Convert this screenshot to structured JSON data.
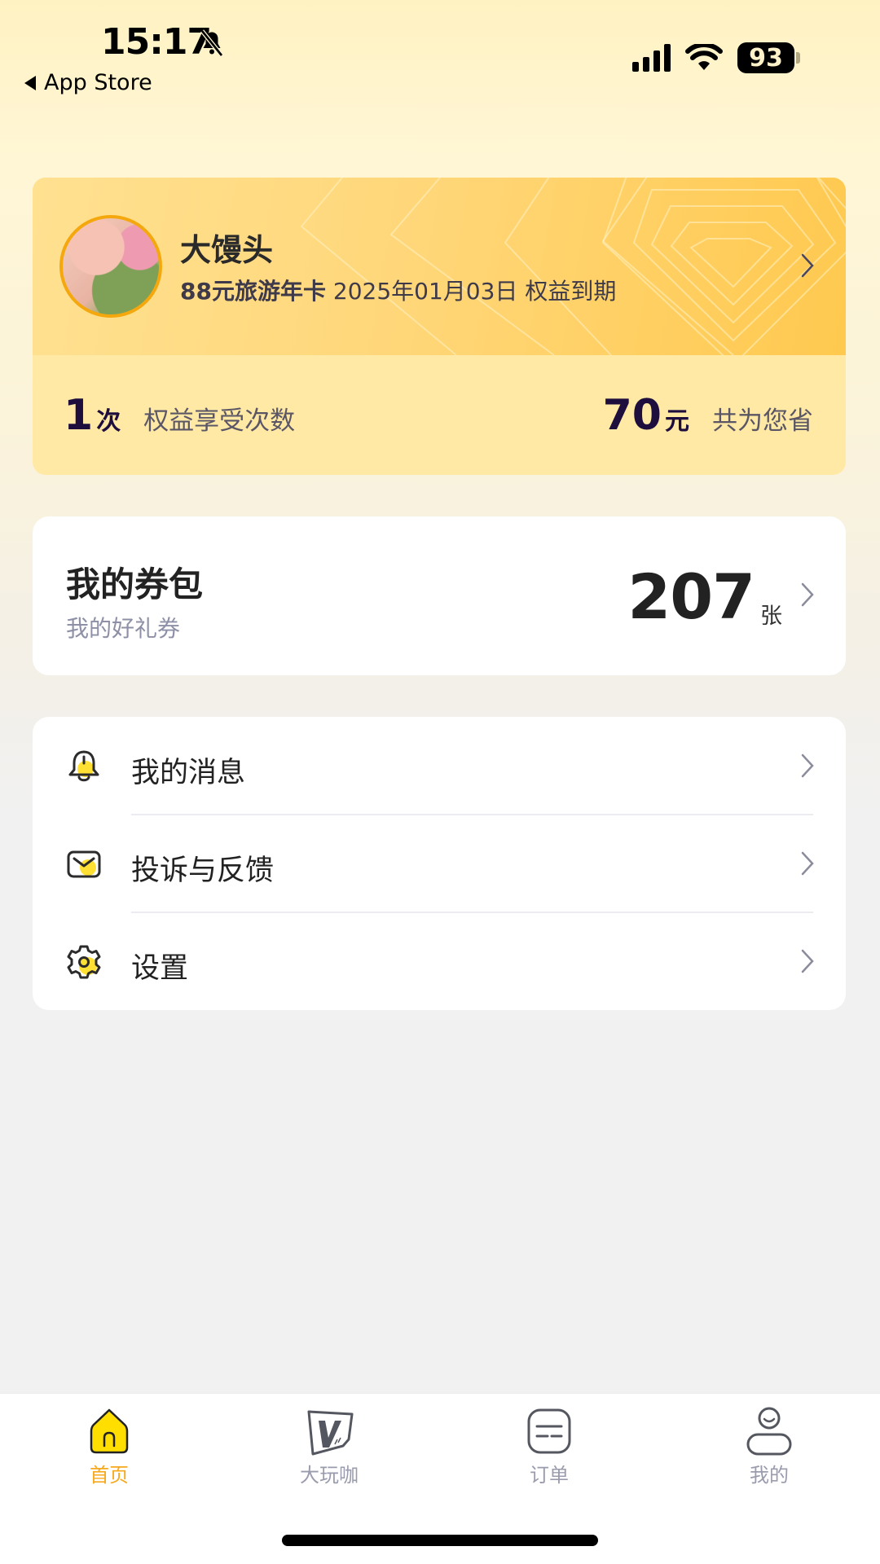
{
  "status_bar": {
    "time": "15:17",
    "back_label": "App Store",
    "battery": "93",
    "icons": [
      "bell-slash-icon",
      "cellular-signal-icon",
      "wifi-icon",
      "battery-icon"
    ]
  },
  "member_card": {
    "name": "大馒头",
    "card_name": "88元旅游年卡",
    "expiry_date": "2025年01月03日",
    "expiry_label": "权益到期",
    "usage_count": "1",
    "usage_unit": "次",
    "usage_label": "权益享受次数",
    "saved_amount": "70",
    "saved_unit": "元",
    "saved_label": "共为您省"
  },
  "coupon_card": {
    "title": "我的券包",
    "subtitle": "我的好礼券",
    "count": "207",
    "unit": "张"
  },
  "menu": {
    "items": [
      {
        "label": "我的消息",
        "icon": "bell-icon"
      },
      {
        "label": "投诉与反馈",
        "icon": "envelope-icon"
      },
      {
        "label": "设置",
        "icon": "gear-icon"
      }
    ]
  },
  "tabbar": {
    "tabs": [
      {
        "label": "首页",
        "icon": "home-icon",
        "active": true
      },
      {
        "label": "大玩咖",
        "icon": "v-card-icon",
        "active": false
      },
      {
        "label": "订单",
        "icon": "order-icon",
        "active": false
      },
      {
        "label": "我的",
        "icon": "profile-icon",
        "active": false
      }
    ]
  },
  "colors": {
    "accent": "#FFD600",
    "active_tab_text": "#F7A91E",
    "card_gold": "#FFC94F",
    "dark_number": "#1E0E3E"
  }
}
